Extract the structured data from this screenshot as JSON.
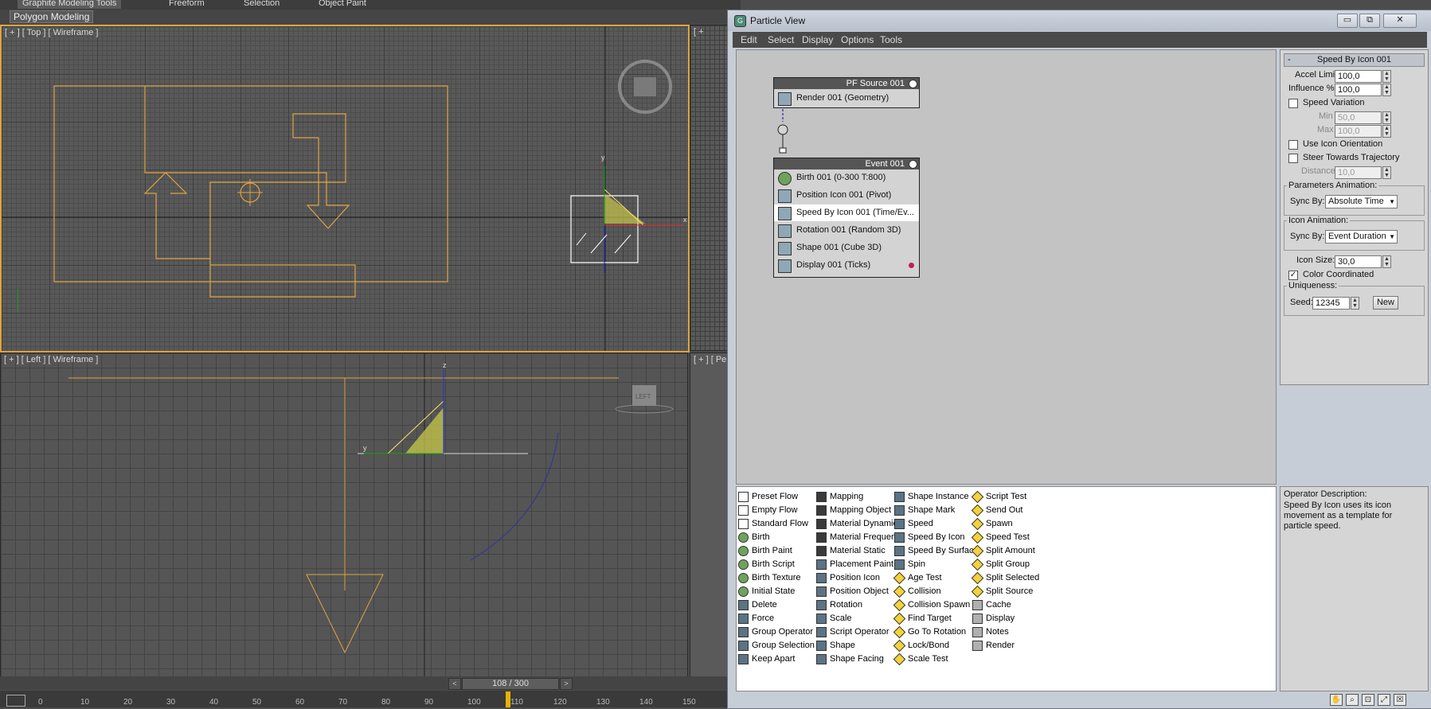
{
  "ribbon": {
    "tabs": [
      "Graphite Modeling Tools",
      "Freeform",
      "Selection",
      "Object Paint"
    ],
    "sub_label": "Polygon Modeling"
  },
  "viewports": {
    "top": "[ + ] [ Top ] [ Wireframe ]",
    "left": "[ + ] [ Left ] [ Wireframe ]",
    "persp": "[ + ] [ Pe",
    "right_top": "[ +",
    "axis_z": "z",
    "axis_y": "y",
    "axis_x": "x",
    "viewcube_label": "LEFT"
  },
  "timeline": {
    "frame": "108 / 300",
    "prev": "<",
    "next": ">",
    "ticks": [
      "0",
      "10",
      "20",
      "30",
      "40",
      "50",
      "60",
      "70",
      "80",
      "90",
      "100",
      "110",
      "120",
      "130",
      "140",
      "150"
    ]
  },
  "particle_view": {
    "title": "Particle View",
    "app_icon_glyph": "G",
    "window_buttons": {
      "minimize": "▭",
      "restore": "⧉",
      "close": "✕"
    },
    "menu": [
      "Edit",
      "Select",
      "Display",
      "Options",
      "Tools"
    ],
    "source_node": {
      "title": "PF Source 001",
      "operators": [
        "Render 001 (Geometry)"
      ]
    },
    "event_node": {
      "title": "Event 001",
      "operators": [
        "Birth 001 (0-300 T:800)",
        "Position Icon 001 (Pivot)",
        "Speed By Icon 001 (Time/Ev...",
        "Rotation 001 (Random 3D)",
        "Shape 001 (Cube 3D)",
        "Display 001 (Ticks)"
      ],
      "display_color": "#c21f5a"
    },
    "depot": {
      "col1": [
        {
          "label": "Preset Flow",
          "kind": "flow"
        },
        {
          "label": "Empty Flow",
          "kind": "flow"
        },
        {
          "label": "Standard Flow",
          "kind": "flow"
        },
        {
          "label": "Birth",
          "kind": "birth"
        },
        {
          "label": "Birth Paint",
          "kind": "birth"
        },
        {
          "label": "Birth Script",
          "kind": "birth"
        },
        {
          "label": "Birth Texture",
          "kind": "birth"
        },
        {
          "label": "Initial State",
          "kind": "birth"
        },
        {
          "label": "Delete",
          "kind": "op"
        },
        {
          "label": "Force",
          "kind": "op"
        },
        {
          "label": "Group Operator",
          "kind": "op"
        },
        {
          "label": "Group Selection",
          "kind": "op"
        },
        {
          "label": "Keep Apart",
          "kind": "op"
        }
      ],
      "col2": [
        {
          "label": "Mapping",
          "kind": "op2"
        },
        {
          "label": "Mapping Object",
          "kind": "op2"
        },
        {
          "label": "Material Dynamic",
          "kind": "op2"
        },
        {
          "label": "Material Frequency",
          "kind": "op2"
        },
        {
          "label": "Material Static",
          "kind": "op2"
        },
        {
          "label": "Placement Paint",
          "kind": "op"
        },
        {
          "label": "Position Icon",
          "kind": "op"
        },
        {
          "label": "Position Object",
          "kind": "op"
        },
        {
          "label": "Rotation",
          "kind": "op"
        },
        {
          "label": "Scale",
          "kind": "op"
        },
        {
          "label": "Script Operator",
          "kind": "op"
        },
        {
          "label": "Shape",
          "kind": "op"
        },
        {
          "label": "Shape Facing",
          "kind": "op"
        }
      ],
      "col3": [
        {
          "label": "Shape Instance",
          "kind": "op"
        },
        {
          "label": "Shape Mark",
          "kind": "op"
        },
        {
          "label": "Speed",
          "kind": "op"
        },
        {
          "label": "Speed By Icon",
          "kind": "op"
        },
        {
          "label": "Speed By Surface",
          "kind": "op"
        },
        {
          "label": "Spin",
          "kind": "op"
        },
        {
          "label": "Age Test",
          "kind": "test"
        },
        {
          "label": "Collision",
          "kind": "test"
        },
        {
          "label": "Collision Spawn",
          "kind": "test"
        },
        {
          "label": "Find Target",
          "kind": "test"
        },
        {
          "label": "Go To Rotation",
          "kind": "test"
        },
        {
          "label": "Lock/Bond",
          "kind": "test"
        },
        {
          "label": "Scale Test",
          "kind": "test"
        }
      ],
      "col4": [
        {
          "label": "Script Test",
          "kind": "test"
        },
        {
          "label": "Send Out",
          "kind": "test"
        },
        {
          "label": "Spawn",
          "kind": "test"
        },
        {
          "label": "Speed Test",
          "kind": "test"
        },
        {
          "label": "Split Amount",
          "kind": "test"
        },
        {
          "label": "Split Group",
          "kind": "test"
        },
        {
          "label": "Split Selected",
          "kind": "test"
        },
        {
          "label": "Split Source",
          "kind": "test"
        },
        {
          "label": "Cache",
          "kind": "misc"
        },
        {
          "label": "Display",
          "kind": "misc"
        },
        {
          "label": "Notes",
          "kind": "misc"
        },
        {
          "label": "Render",
          "kind": "misc"
        }
      ]
    },
    "params": {
      "rollout_toggle": "-",
      "rollout_title": "Speed By Icon 001",
      "accel_limit_label": "Accel Limit:",
      "accel_limit": "100,0",
      "influence_label": "Influence %",
      "influence": "100,0",
      "speed_variation_label": "Speed Variation",
      "speed_variation": false,
      "min_label": "Min %",
      "min": "50,0",
      "max_label": "Max %",
      "max": "100,0",
      "use_icon_orientation_label": "Use Icon Orientation",
      "use_icon_orientation": false,
      "steer_label": "Steer Towards Trajectory",
      "steer": false,
      "distance_label": "Distance:",
      "distance": "10,0",
      "param_anim_title": "Parameters Animation:",
      "param_sync_label": "Sync By:",
      "param_sync_value": "Absolute Time",
      "icon_anim_title": "Icon Animation:",
      "icon_sync_label": "Sync By:",
      "icon_sync_value": "Event Duration",
      "icon_size_label": "Icon Size:",
      "icon_size": "30,0",
      "color_coordinated_label": "Color Coordinated",
      "color_coordinated": true,
      "check_glyph": "✓",
      "uniqueness_title": "Uniqueness:",
      "seed_label": "Seed:",
      "seed": "12345",
      "new_button": "New"
    },
    "description": {
      "title": "Operator Description:",
      "text": "Speed By Icon uses its icon movement as a template for particle speed."
    }
  }
}
